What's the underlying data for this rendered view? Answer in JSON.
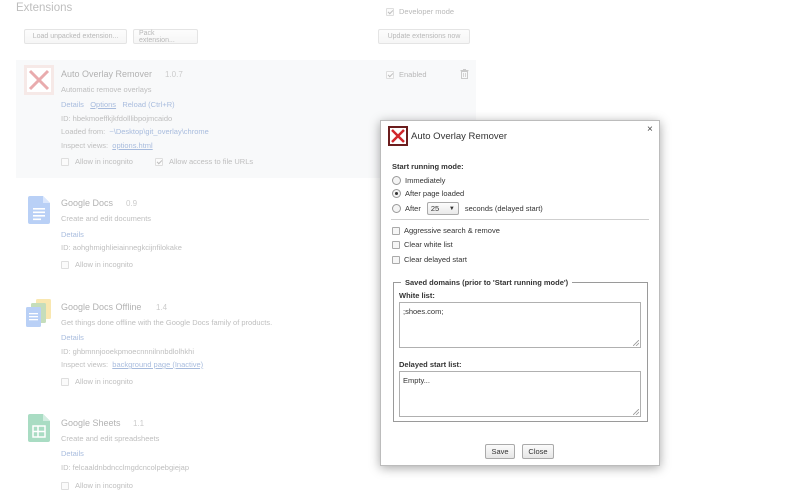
{
  "page": {
    "title": "Extensions",
    "developer_mode_label": "Developer mode",
    "buttons": {
      "load_unpacked": "Load unpacked extension...",
      "pack": "Pack extension...",
      "update": "Update extensions now"
    }
  },
  "extensions": [
    {
      "name": "Auto Overlay Remover",
      "version": "1.0.7",
      "description": "Automatic remove overlays",
      "links": {
        "details": "Details",
        "options": "Options",
        "reload": "Reload (Ctrl+R)"
      },
      "id_line": "ID: hbekmoeffkjkfdolllibpojmcaido",
      "loaded_from_label": "Loaded from:",
      "loaded_from_path": "~\\Desktop\\git_overlay\\chrome",
      "inspect_label": "Inspect views:",
      "inspect_link": "options.html",
      "incognito_label": "Allow in incognito",
      "file_urls_label": "Allow access to file URLs",
      "enabled_label": "Enabled"
    },
    {
      "name": "Google Docs",
      "version": "0.9",
      "description": "Create and edit documents",
      "details": "Details",
      "id_line": "ID: aohghmighlieiainnegkcijnfilokake",
      "incognito_label": "Allow in incognito"
    },
    {
      "name": "Google Docs Offline",
      "version": "1.4",
      "description": "Get things done offline with the Google Docs family of products.",
      "details": "Details",
      "id_line": "ID: ghbmnnjooekpmoecnnnilnnbdlolhkhi",
      "inspect_label": "Inspect views:",
      "inspect_link": "background page (Inactive)",
      "incognito_label": "Allow in incognito"
    },
    {
      "name": "Google Sheets",
      "version": "1.1",
      "description": "Create and edit spreadsheets",
      "details": "Details",
      "id_line": "ID: felcaaldnbdncclmgdcncolpebgiejap",
      "incognito_label": "Allow in incognito"
    }
  ],
  "dialog": {
    "title": "Auto Overlay Remover",
    "close_glyph": "×",
    "start_mode_label": "Start running mode:",
    "options": {
      "immediately": "Immediately",
      "after_page_loaded": "After page loaded",
      "after": "After",
      "delay_value": "25",
      "delay_suffix": "seconds (delayed start)"
    },
    "selected_mode": "after_page_loaded",
    "checkboxes": {
      "aggressive": "Aggressive search & remove",
      "clear_white": "Clear white list",
      "clear_delayed": "Clear delayed start"
    },
    "saved_domains_legend": "Saved domains (prior to 'Start running mode')",
    "white_list_label": "White list:",
    "white_list_value": ";shoes.com;",
    "delayed_list_label": "Delayed start list:",
    "delayed_list_value": "Empty...",
    "save_label": "Save",
    "close_label": "Close"
  },
  "colors": {
    "link": "#1a4fa8",
    "selected_row": "#eef0f3",
    "docs_blue": "#4a86e8",
    "sheets_green": "#1fa463"
  }
}
